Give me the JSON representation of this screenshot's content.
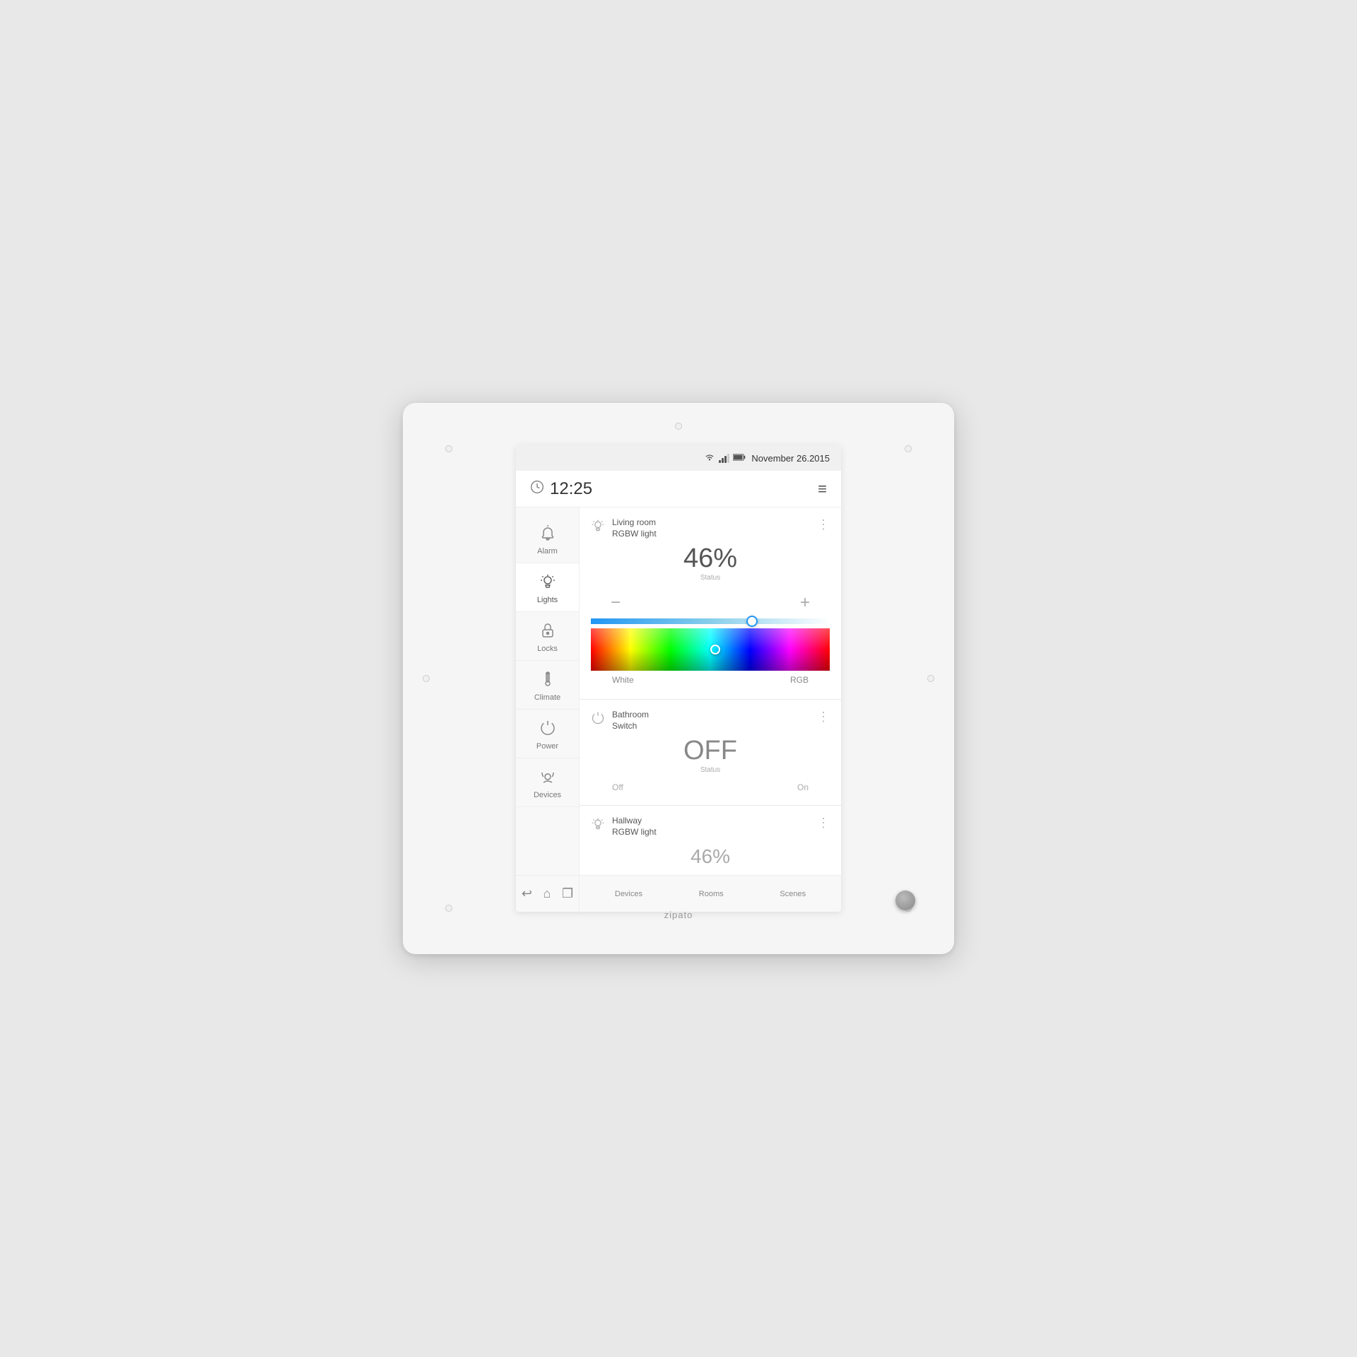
{
  "device": {
    "brand": "zipato"
  },
  "status_bar": {
    "date": "November 26.2015",
    "wifi": "wifi",
    "battery": "battery"
  },
  "top_bar": {
    "time": "12:25",
    "menu": "≡"
  },
  "sidebar": {
    "items": [
      {
        "id": "alarm",
        "label": "Alarm",
        "icon": "🔔"
      },
      {
        "id": "lights",
        "label": "Lights",
        "icon": "💡",
        "active": true
      },
      {
        "id": "locks",
        "label": "Locks",
        "icon": "🔒"
      },
      {
        "id": "climate",
        "label": "Climate",
        "icon": "🌡"
      },
      {
        "id": "power",
        "label": "Power",
        "icon": "⏻"
      },
      {
        "id": "devices",
        "label": "Devices",
        "icon": "⛅"
      }
    ]
  },
  "cards": {
    "living_room": {
      "title": "Living room\nRGBW light",
      "value": "46%",
      "status_label": "Status",
      "minus": "−",
      "plus": "+"
    },
    "bathroom": {
      "title": "Bathroom\nSwitch",
      "value": "OFF",
      "status_label": "Status",
      "off_label": "Off",
      "on_label": "On"
    },
    "hallway": {
      "title": "Hallway\nRGBW light",
      "value": "46%"
    }
  },
  "color_labels": {
    "white": "White",
    "rgb": "RGB"
  },
  "bottom_tabs": [
    {
      "label": "Devices"
    },
    {
      "label": "Rooms"
    },
    {
      "label": "Scenes"
    }
  ],
  "nav_buttons": {
    "back": "↩",
    "home": "⌂",
    "apps": "❐"
  }
}
